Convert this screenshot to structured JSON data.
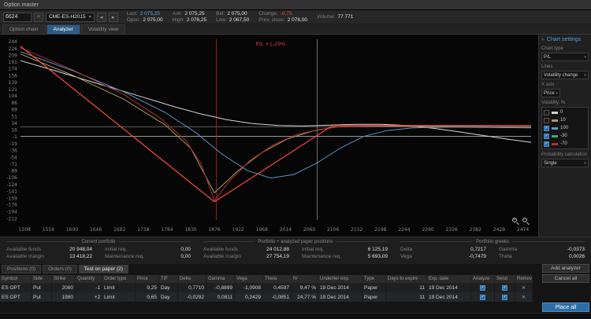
{
  "window": {
    "title": "Option master"
  },
  "toolbar": {
    "symbol": "6624",
    "contract": "CME-ES-H2015",
    "quote_columns": [
      [
        {
          "label": "Last:",
          "value": "2 075,25",
          "cls": "blue"
        },
        {
          "label": "Open:",
          "value": "2 075,00"
        }
      ],
      [
        {
          "label": "Ask:",
          "value": "2 075,25"
        },
        {
          "label": "High:",
          "value": "2 076,25"
        }
      ],
      [
        {
          "label": "Bid:",
          "value": "2 075,00"
        },
        {
          "label": "Low:",
          "value": "2 067,50"
        }
      ],
      [
        {
          "label": "Change:",
          "value": "-0,75",
          "cls": "red"
        },
        {
          "label": "Prev. close:",
          "value": "2 076,00"
        }
      ],
      [
        {
          "label": "Volume:",
          "value": "77 771"
        }
      ]
    ]
  },
  "tabs": [
    {
      "label": "Option chain",
      "active": false
    },
    {
      "label": "Analyzer",
      "active": true
    },
    {
      "label": "Volatility view",
      "active": false
    }
  ],
  "chart_data": {
    "type": "line",
    "title": "P/L",
    "x_range": [
      1500,
      2490
    ],
    "y_range": [
      -215,
      250
    ],
    "x_ticks": [
      1508,
      1554,
      1600,
      1646,
      1692,
      1738,
      1784,
      1830,
      1876,
      1922,
      1968,
      2014,
      2060,
      2106,
      2152,
      2198,
      2244,
      2290,
      2336,
      2382,
      2428,
      2474
    ],
    "y_ticks": [
      244,
      226,
      209,
      191,
      174,
      156,
      139,
      121,
      104,
      86,
      69,
      51,
      34,
      16,
      -1,
      -19,
      -36,
      -54,
      -71,
      -89,
      -106,
      -124,
      -141,
      -159,
      -176,
      -194,
      -212
    ],
    "hlines": [
      {
        "y": 25,
        "color": "#6a6a6a"
      },
      {
        "y": 0,
        "color": "#c8c8c8"
      }
    ],
    "vlines": [
      {
        "x": 1880,
        "color": "#b82828"
      },
      {
        "x": 2075,
        "color": "#8a8a8a"
      }
    ],
    "crosshair_label": "P/L +1,29%",
    "crosshair_x": 1985,
    "series": [
      {
        "name": "vol 0",
        "color": "#d4d4d4",
        "points": [
          [
            1500,
            195
          ],
          [
            1560,
            172
          ],
          [
            1620,
            148
          ],
          [
            1680,
            124
          ],
          [
            1740,
            100
          ],
          [
            1800,
            76
          ],
          [
            1850,
            58
          ],
          [
            1900,
            43
          ],
          [
            1950,
            33
          ],
          [
            2000,
            28
          ],
          [
            2050,
            27
          ],
          [
            2100,
            29
          ],
          [
            2150,
            31
          ],
          [
            2200,
            31
          ],
          [
            2250,
            28
          ],
          [
            2300,
            21
          ],
          [
            2350,
            12
          ],
          [
            2400,
            2
          ],
          [
            2450,
            -8
          ],
          [
            2490,
            -15
          ]
        ]
      },
      {
        "name": "vol 10",
        "color": "#a89a55",
        "points": [
          [
            1500,
            212
          ],
          [
            1600,
            158
          ],
          [
            1700,
            96
          ],
          [
            1780,
            30
          ],
          [
            1830,
            -30
          ],
          [
            1876,
            -145
          ],
          [
            1920,
            -90
          ],
          [
            1970,
            -40
          ],
          [
            2020,
            -5
          ],
          [
            2070,
            15
          ],
          [
            2110,
            24
          ],
          [
            2160,
            26
          ],
          [
            2250,
            26
          ],
          [
            2400,
            25
          ],
          [
            2490,
            24
          ]
        ]
      },
      {
        "name": "vol 100",
        "color": "#5b94c8",
        "points": [
          [
            1500,
            218
          ],
          [
            1600,
            170
          ],
          [
            1700,
            115
          ],
          [
            1780,
            62
          ],
          [
            1840,
            10
          ],
          [
            1890,
            -45
          ],
          [
            1940,
            -88
          ],
          [
            1985,
            -107
          ],
          [
            2030,
            -98
          ],
          [
            2075,
            -68
          ],
          [
            2120,
            -30
          ],
          [
            2165,
            0
          ],
          [
            2210,
            15
          ],
          [
            2260,
            22
          ],
          [
            2330,
            24
          ],
          [
            2420,
            23
          ],
          [
            2490,
            22
          ]
        ]
      },
      {
        "name": "vol -70",
        "color": "#b03030",
        "points": [
          [
            1500,
            228
          ],
          [
            1600,
            172
          ],
          [
            1700,
            108
          ],
          [
            1770,
            48
          ],
          [
            1820,
            -10
          ],
          [
            1850,
            -70
          ],
          [
            1876,
            -165
          ],
          [
            1905,
            -115
          ],
          [
            1945,
            -62
          ],
          [
            1990,
            -22
          ],
          [
            2035,
            5
          ],
          [
            2080,
            18
          ],
          [
            2120,
            25
          ],
          [
            2170,
            27
          ],
          [
            2250,
            28
          ],
          [
            2400,
            28
          ],
          [
            2490,
            28
          ]
        ]
      },
      {
        "name": "expiration",
        "color": "#ff4a3a",
        "points": [
          [
            1500,
            232
          ],
          [
            1876,
            -168
          ],
          [
            2105,
            28
          ],
          [
            2490,
            28
          ]
        ]
      }
    ]
  },
  "sidebar": {
    "title": "Chart settings",
    "chart_type_label": "Chart type",
    "chart_type_value": "P/L",
    "lines_label": "Lines",
    "lines_value": "Volatility change",
    "axis_label": "X axis",
    "axis_value": "Price",
    "volatility_label": "Volatility, %",
    "volatility_items": [
      {
        "label": "0",
        "color": "#d4d4d4",
        "checked": false
      },
      {
        "label": "10",
        "color": "#a89a55",
        "checked": false
      },
      {
        "label": "100",
        "color": "#5b94c8",
        "checked": true
      },
      {
        "label": "-30",
        "color": "#3fae6a",
        "checked": true
      },
      {
        "label": "-70",
        "color": "#b03030",
        "checked": true
      }
    ],
    "probability_label": "Probability calculation",
    "probability_value": "Single"
  },
  "portfolio": {
    "sections": [
      {
        "title": "Current portfolio",
        "pairs": [
          [
            "Available funds",
            "20 948,04"
          ],
          [
            "Initial req.",
            "0,00"
          ],
          [
            "Available margin",
            "13 418,22"
          ],
          [
            "Maintenance req.",
            "0,00"
          ]
        ]
      },
      {
        "title": "Portfolio + analyzed paper positions",
        "pairs": [
          [
            "Available funds",
            "24 012,88"
          ],
          [
            "Initial req.",
            "6 125,19"
          ],
          [
            "Available margin",
            "27 754,19"
          ],
          [
            "Maintenance req.",
            "5 693,09"
          ]
        ]
      },
      {
        "title": "Portfolio greeks",
        "pairs": [
          [
            "Delta",
            "0,7217"
          ],
          [
            "Gamma",
            "-0,0373"
          ],
          [
            "Vega",
            "-0,7479"
          ],
          [
            "Theta",
            "0,0026"
          ]
        ]
      }
    ]
  },
  "positions_tabs": [
    {
      "label": "Positions (0)",
      "active": false
    },
    {
      "label": "Orders (0)",
      "active": false
    },
    {
      "label": "Test on paper (2)",
      "active": true
    }
  ],
  "actions": {
    "add_analyzer": "Add analyzer",
    "cancel_all": "Cancel all",
    "place_all": "Place all"
  },
  "table": {
    "headers": [
      "Symbol",
      "Side",
      "Strike",
      "Quantity",
      "Order type",
      "Price",
      "TIF",
      "Delta",
      "Gamma",
      "Vega",
      "Theta",
      "IV",
      "Underlier exp.",
      "Type",
      "Days to expire",
      "Exp. date",
      "Analyze",
      "Send",
      "Remove"
    ],
    "rows": [
      {
        "cells": [
          "ES OPT",
          "Put",
          "2080",
          "-1",
          "Limit",
          "9,25",
          "Day",
          "0,7710",
          "-0,8899",
          "-1,0908",
          "0,4597",
          "9,47 %",
          "19 Dec 2014",
          "Paper",
          "11",
          "19 Dec 2014"
        ],
        "analyze": true,
        "send": true
      },
      {
        "cells": [
          "ES OPT",
          "Put",
          "1980",
          "+2",
          "Limit",
          "0,65",
          "Day",
          "-0,0292",
          "0,0811",
          "0,2429",
          "-0,0851",
          "24,77 %",
          "19 Dec 2014",
          "Paper",
          "11",
          "19 Dec 2014"
        ],
        "analyze": true,
        "send": true
      }
    ]
  },
  "zoom": {
    "zoom_in": "+",
    "zoom_out": "−"
  }
}
